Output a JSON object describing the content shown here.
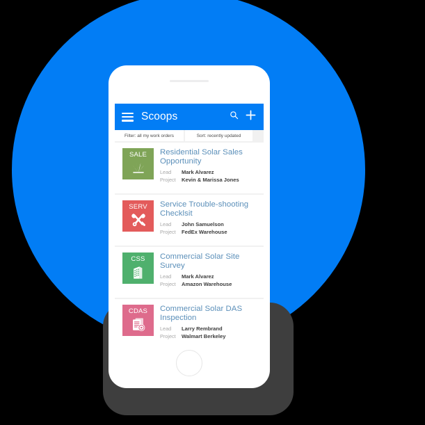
{
  "scene": {
    "background_color": "#000000",
    "circle_color": "#027DF5",
    "shadow_color": "#3E3E3E",
    "phone_color": "#FFFFFF"
  },
  "app_bar": {
    "title": "Scoops",
    "menu_icon": "hamburger-icon",
    "search_icon": "search-icon",
    "add_icon": "plus-icon",
    "background_color": "#027DF5"
  },
  "chips": {
    "filter": "Filter: all my work orders",
    "sort": "Sort: recently updated"
  },
  "labels": {
    "lead": "Lead",
    "project": "Project"
  },
  "cards": [
    {
      "code": "SALE",
      "icon": "grass-icon",
      "color": "#7FA457",
      "title": "Residential Solar Sales Opportunity",
      "lead": "Mark Alvarez",
      "project": "Kevin & Marissa Jones"
    },
    {
      "code": "SERV",
      "icon": "tools-icon",
      "color": "#E35B5B",
      "title": "Service Trouble-shooting Checklsit",
      "lead": "John Samuelson",
      "project": "FedEx Warehouse"
    },
    {
      "code": "CSS",
      "icon": "building-icon",
      "color": "#4FB06D",
      "title": "Commercial Solar Site Survey",
      "lead": "Mark Alvarez",
      "project": "Amazon Warehouse"
    },
    {
      "code": "CDAS",
      "icon": "document-inspect-icon",
      "color": "#DE6B8C",
      "title": "Commercial Solar DAS Inspection",
      "lead": "Larry Rembrand",
      "project": "Walmart Berkeley"
    }
  ]
}
